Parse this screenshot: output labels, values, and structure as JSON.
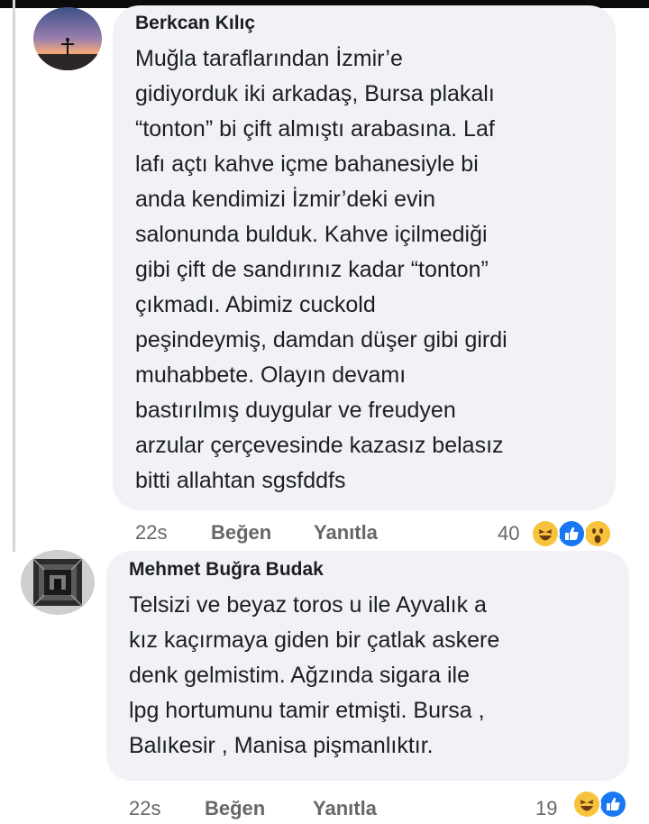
{
  "comments": [
    {
      "author": "Berkcan Kılıç",
      "text": "Muğla taraflarından İzmir’e\ngidiyorduk iki arkadaş, Bursa plakalı\n“tonton” bi çift almıştı arabasına. Laf\nlafı açtı kahve içme bahanesiyle bi\nanda kendimizi İzmir’deki evin\nsalonunda bulduk. Kahve içilmediği\ngibi çift de sandırınız kadar “tonton”\nçıkmadı. Abimiz cuckold\npeşindeymiş, damdan düşer gibi girdi\nmuhabbete. Olayın devamı\nbastırılmış duygular ve freudyen\narzular çerçevesinde kazasız belasız\nbitti allahtan sgsfddfs",
      "time": "22s",
      "like_label": "Beğen",
      "reply_label": "Yanıtla",
      "reaction_count": "40",
      "reactions": [
        "haha-icon",
        "like-icon",
        "wow-icon"
      ]
    },
    {
      "author": "Mehmet Buğra Budak",
      "text": "Telsizi ve beyaz toros u ile Ayvalık a\nkız kaçırmaya giden bir çatlak askere\ndenk gelmistim. Ağzında sigara ile\nlpg hortumunu tamir etmişti. Bursa ,\nBalıkesir , Manisa pişmanlıktır.",
      "time": "22s",
      "like_label": "Beğen",
      "reply_label": "Yanıtla",
      "reaction_count": "19",
      "reactions": [
        "haha-icon",
        "like-icon"
      ]
    }
  ],
  "colors": {
    "bubble": "#f0f2f5",
    "text": "#1c1e21",
    "meta": "#65676b",
    "like_blue": "#1877f2",
    "haha_yellow": "#f7c33c"
  }
}
